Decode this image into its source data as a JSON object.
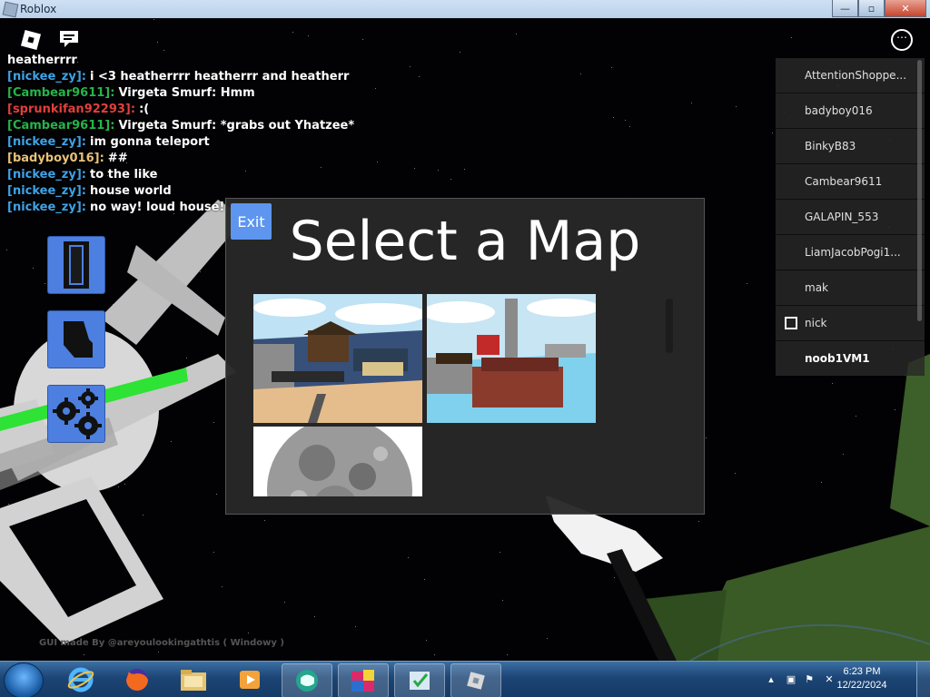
{
  "window": {
    "title": "Roblox",
    "buttons": {
      "minimize": "—",
      "maximize": "▫",
      "close": "✕"
    }
  },
  "chat": [
    {
      "name": "",
      "text": "heatherrrr",
      "color": "#ffffff"
    },
    {
      "name": "[nickee_zy]:",
      "text": "i <3 heatherrrr heatherrr and heatherr",
      "color": "#3ea3e6"
    },
    {
      "name": "[Cambear9611]:",
      "text": "Virgeta Smurf: Hmm",
      "color": "#27b34a"
    },
    {
      "name": "[sprunkifan92293]:",
      "text": ":(",
      "color": "#e0403b"
    },
    {
      "name": "[Cambear9611]:",
      "text": "Virgeta Smurf: *grabs out Yhatzee*",
      "color": "#27b34a"
    },
    {
      "name": "[nickee_zy]:",
      "text": "im gonna teleport",
      "color": "#3ea3e6"
    },
    {
      "name": "[badyboy016]:",
      "text": "##",
      "color": "#e6c27a"
    },
    {
      "name": "[nickee_zy]:",
      "text": "to the like",
      "color": "#3ea3e6"
    },
    {
      "name": "[nickee_zy]:",
      "text": "house world",
      "color": "#3ea3e6"
    },
    {
      "name": "[nickee_zy]:",
      "text": "no way! loud house!",
      "color": "#3ea3e6"
    }
  ],
  "players": [
    {
      "name": "AttentionShoppe..."
    },
    {
      "name": "badyboy016"
    },
    {
      "name": "BinkyB83"
    },
    {
      "name": "Cambear9611"
    },
    {
      "name": "GALAPIN_553"
    },
    {
      "name": "LiamJacobPogi1..."
    },
    {
      "name": "mak"
    },
    {
      "name": "nick"
    },
    {
      "name": "noob1VM1"
    }
  ],
  "map_select": {
    "exit_label": "Exit",
    "title": "Select a Map",
    "maps": [
      "beach-city-map",
      "red-building-map",
      "moon-map"
    ]
  },
  "credit": "GUI made By @areyoulookingathtis ( Windowy )",
  "taskbar": {
    "time": "6:23 PM",
    "date": "12/22/2024",
    "apps": [
      "internet-explorer",
      "firefox",
      "file-explorer",
      "media-player",
      "game-app",
      "paint-app",
      "task-app",
      "roblox-app"
    ]
  },
  "colors": {
    "accent": "#4d7fe0",
    "panel": "#282828",
    "exit": "#5d95ef"
  }
}
